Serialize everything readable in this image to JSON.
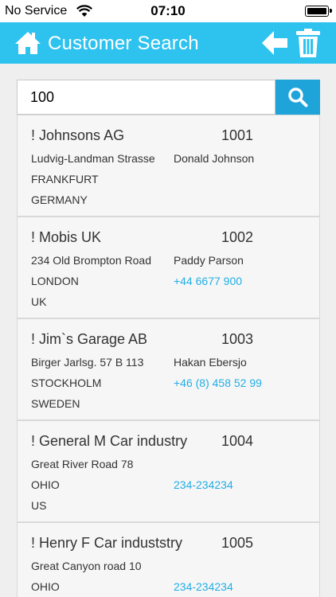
{
  "status_bar": {
    "carrier": "No Service",
    "time": "07:10"
  },
  "header": {
    "title": "Customer Search"
  },
  "search": {
    "value": "100",
    "placeholder": ""
  },
  "colors": {
    "header": "#2ec2ef",
    "search_button": "#1fa4d9",
    "link": "#22aee4"
  },
  "customers": [
    {
      "name": "! Johnsons AG",
      "number": "1001",
      "address": "Ludvig-Landman Strasse",
      "contact": "Donald Johnson",
      "phone": "",
      "city": "FRANKFURT",
      "country": "GERMANY"
    },
    {
      "name": "! Mobis UK",
      "number": "1002",
      "address": "234 Old Brompton Road",
      "contact": "Paddy Parson",
      "phone": "+44 6677 900",
      "city": "LONDON",
      "country": "UK"
    },
    {
      "name": "! Jim`s Garage AB",
      "number": "1003",
      "address": "Birger Jarlsg. 57 B 113",
      "contact": "Hakan Ebersjo",
      "phone": "+46 (8) 458 52 99",
      "city": "STOCKHOLM",
      "country": "SWEDEN"
    },
    {
      "name": "! General M Car industry",
      "number": "1004",
      "address": "Great River Road 78",
      "contact": "",
      "phone": "234-234234",
      "city": "OHIO",
      "country": "US"
    },
    {
      "name": "! Henry F Car induststry",
      "number": "1005",
      "address": "Great Canyon road 10",
      "contact": "",
      "phone": "234-234234",
      "city": "OHIO",
      "country": ""
    }
  ]
}
